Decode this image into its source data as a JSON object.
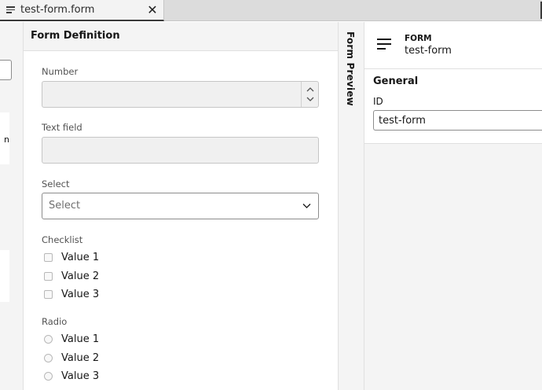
{
  "tabbar": {
    "active_tab_title": "test-form.form",
    "close_glyph": "✕",
    "tab_icon": "form-file-icon"
  },
  "left_panel": {
    "partial_text": "n"
  },
  "editor": {
    "title": "Form Definition",
    "fields": {
      "number_label": "Number",
      "text_label": "Text field",
      "select_label": "Select",
      "select_placeholder": "Select",
      "checklist_label": "Checklist",
      "checklist_options": [
        "Value 1",
        "Value 2",
        "Value 3"
      ],
      "radio_label": "Radio",
      "radio_options": [
        "Value 1",
        "Value 2",
        "Value 3"
      ]
    }
  },
  "preview_tab": {
    "label": "Form Preview"
  },
  "properties": {
    "icon": "form-icon",
    "element_type": "FORM",
    "element_name": "test-form",
    "group_title": "General",
    "id_label": "ID",
    "id_value": "test-form"
  },
  "colors": {
    "panel_bg": "#f4f4f4",
    "border": "#c6c6c6",
    "text": "#161616"
  }
}
